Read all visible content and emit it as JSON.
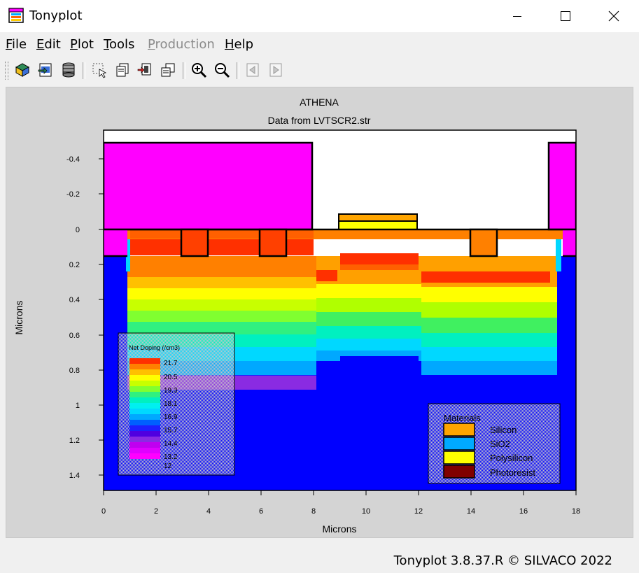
{
  "window": {
    "title": "Tonyplot",
    "icon": "tonyplot-app-icon",
    "controls": [
      "minimize-icon",
      "maximize-icon",
      "close-icon"
    ]
  },
  "menu": [
    {
      "label": "File",
      "mnemonic": "F",
      "rest": "ile",
      "enabled": true
    },
    {
      "label": "Edit",
      "mnemonic": "E",
      "rest": "dit",
      "enabled": true
    },
    {
      "label": "Plot",
      "mnemonic": "P",
      "rest": "lot",
      "enabled": true
    },
    {
      "label": "Tools",
      "mnemonic": "T",
      "rest": "ools",
      "enabled": true
    },
    {
      "label": "Production",
      "mnemonic": "P",
      "rest": "roduction",
      "enabled": false
    },
    {
      "label": "Help",
      "mnemonic": "H",
      "rest": "elp",
      "enabled": true
    }
  ],
  "toolbar": {
    "buttons": [
      "open-icon",
      "import-icon",
      "save-stack-icon",
      "select-region-icon",
      "copy-plot-icon",
      "delete-plot-icon",
      "overlay-icon",
      "zoom-in-icon",
      "zoom-out-icon",
      "previous-icon",
      "next-icon"
    ]
  },
  "plot": {
    "title": "ATHENA",
    "subtitle": "Data from LVTSCR2.str",
    "xlabel": "Microns",
    "ylabel": "Microns",
    "xticks": [
      "0",
      "2",
      "4",
      "6",
      "8",
      "10",
      "12",
      "14",
      "16",
      "18"
    ],
    "yticks": [
      "-0.4",
      "-0.2",
      "0",
      "0.2",
      "0.4",
      "0.6",
      "0.8",
      "1",
      "1.2",
      "1.4"
    ],
    "doping_legend": {
      "title": "Net Doping (/cm3)",
      "labels": [
        "21.7",
        "20.5",
        "19.3",
        "18.1",
        "16.9",
        "15.7",
        "14.4",
        "13.2",
        "12"
      ]
    },
    "materials_legend": {
      "title": "Materials",
      "items": [
        {
          "name": "Silicon",
          "color": "#ffa500"
        },
        {
          "name": "SiO2",
          "color": "#00aaff"
        },
        {
          "name": "Polysilicon",
          "color": "#ffff00"
        },
        {
          "name": "Photoresist",
          "color": "#800000"
        }
      ]
    }
  },
  "status": {
    "text": "Tonyplot 3.8.37.R © SILVACO 2022"
  }
}
